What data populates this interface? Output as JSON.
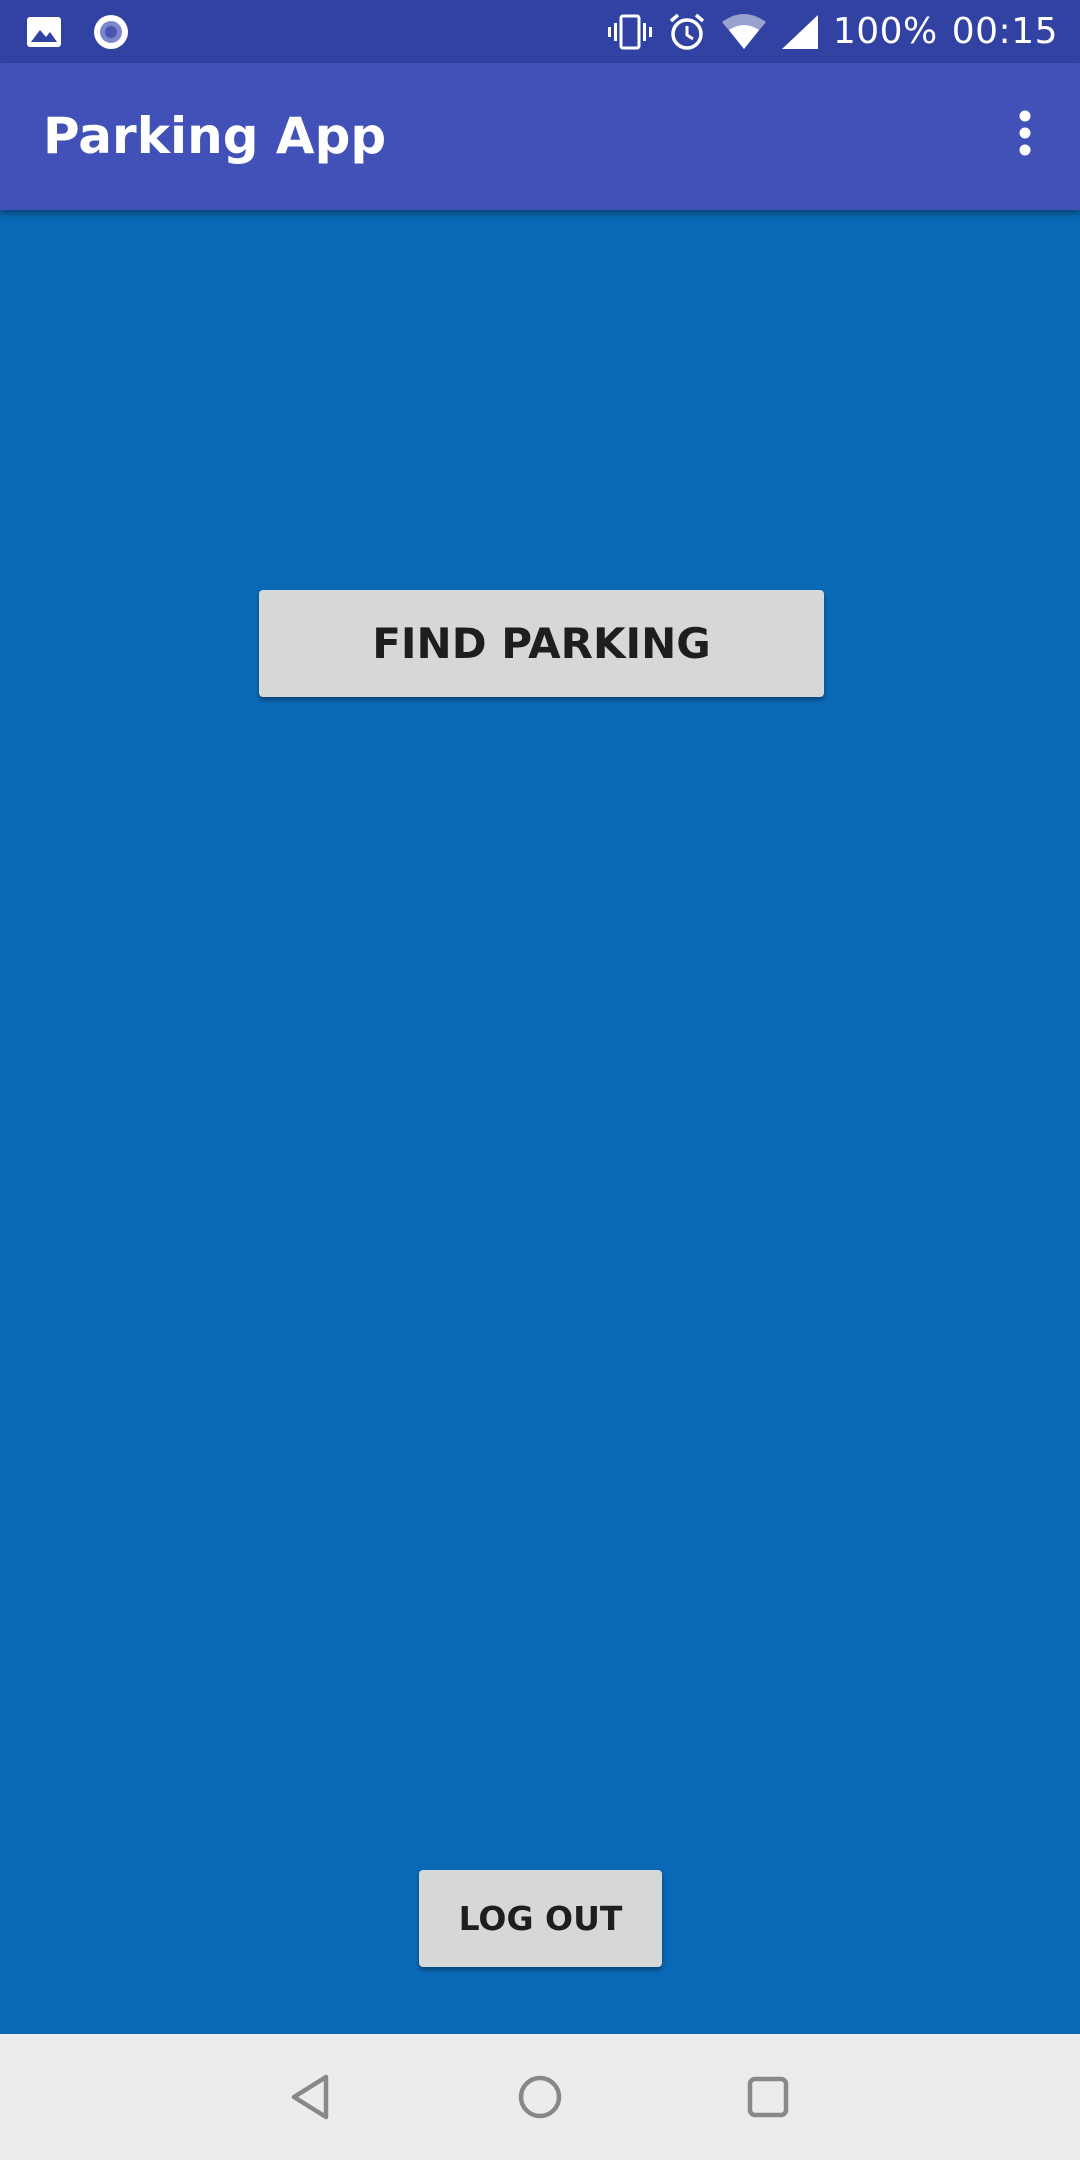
{
  "status_bar": {
    "left_icons": [
      "image-notification-icon",
      "circle-notification-icon"
    ],
    "right_icons": [
      "vibrate-icon",
      "alarm-icon",
      "wifi-icon",
      "cell-signal-icon"
    ],
    "battery": "100%",
    "time": "00:15"
  },
  "app_bar": {
    "title": "Parking App",
    "menu_icon": "overflow-menu-icon"
  },
  "main": {
    "find_parking_label": "FIND PARKING",
    "logout_label": "LOG OUT"
  },
  "nav_bar": {
    "icons": [
      "back-icon",
      "home-icon",
      "recents-icon"
    ]
  },
  "colors": {
    "status_bar_bg": "#3242a2",
    "app_bar_bg": "#4251b8",
    "content_bg": "#0a69b6",
    "button_bg": "#d6d7d7",
    "nav_bar_bg": "#ececec"
  }
}
